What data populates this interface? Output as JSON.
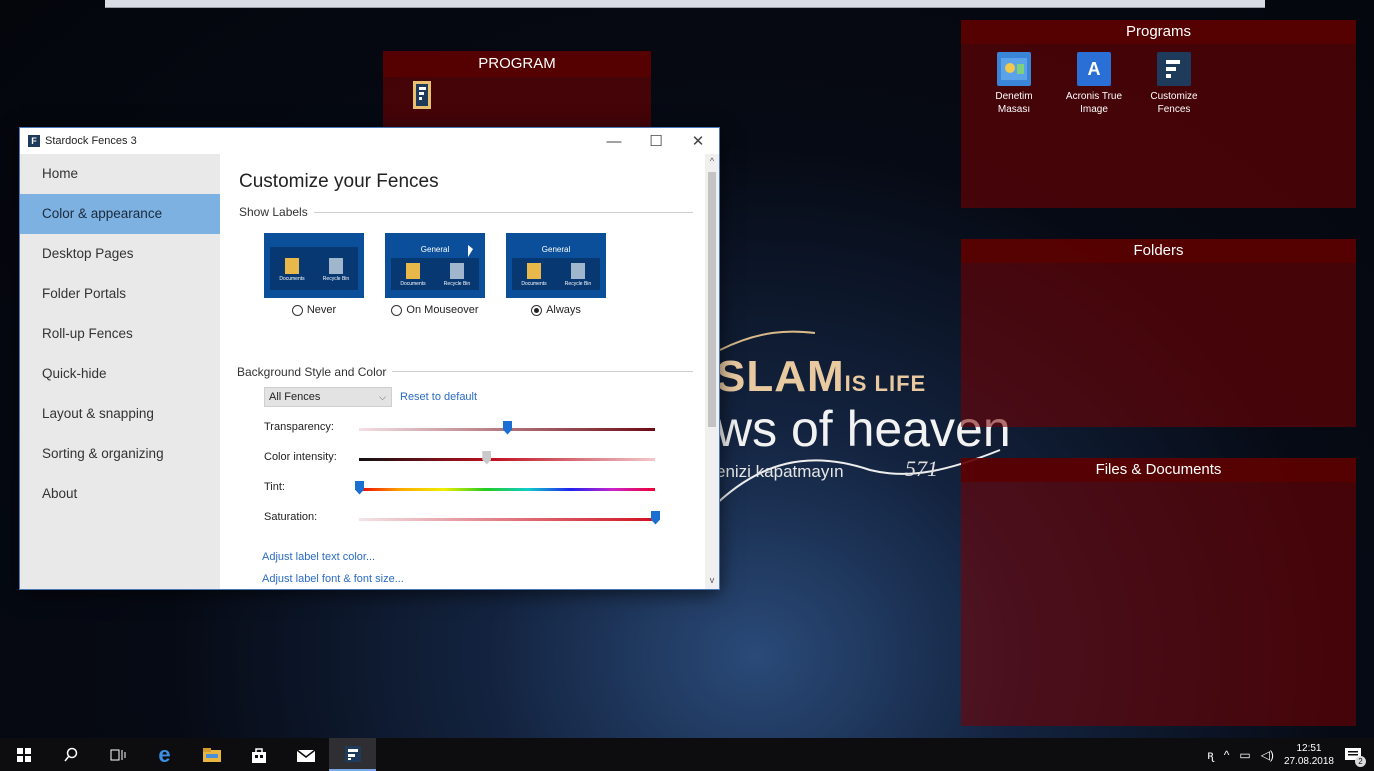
{
  "wallpaper": {
    "line1_big": "SLAM",
    "line1_small": "IS LIFE",
    "line2": "ws of heaven",
    "line3": "enizi kapatmayın",
    "numeral": "571"
  },
  "fences": {
    "program": {
      "title": "PROGRAM",
      "icons": [
        {
          "icon": "fences-app-icon"
        }
      ]
    },
    "programs": {
      "title": "Programs",
      "icons": [
        {
          "label": "Denetim Masası",
          "icon": "control-panel-icon"
        },
        {
          "label": "Acronis True Image",
          "icon": "acronis-icon",
          "glyph": "A"
        },
        {
          "label": "Customize Fences",
          "icon": "fences-app-icon"
        }
      ]
    },
    "folders": {
      "title": "Folders"
    },
    "files": {
      "title": "Files & Documents"
    }
  },
  "window": {
    "title": "Stardock Fences 3",
    "controls": {
      "minimize": "—",
      "maximize": "☐",
      "close": "✕"
    },
    "nav": [
      {
        "label": "Home"
      },
      {
        "label": "Color & appearance",
        "active": true
      },
      {
        "label": "Desktop Pages"
      },
      {
        "label": "Folder Portals"
      },
      {
        "label": "Roll-up Fences"
      },
      {
        "label": "Quick-hide"
      },
      {
        "label": "Layout & snapping"
      },
      {
        "label": "Sorting & organizing"
      },
      {
        "label": "About"
      }
    ],
    "page_title": "Customize your Fences",
    "show_labels": {
      "heading": "Show Labels",
      "preview_title": "General",
      "preview_items": [
        "Documents",
        "Recycle Bin"
      ],
      "options": [
        {
          "label": "Never",
          "selected": false
        },
        {
          "label": "On Mouseover",
          "selected": false
        },
        {
          "label": "Always",
          "selected": true
        }
      ]
    },
    "background": {
      "heading": "Background Style and Color",
      "select_value": "All Fences",
      "reset_link": "Reset to default",
      "sliders": [
        {
          "label": "Transparency:",
          "value": 0.5
        },
        {
          "label": "Color intensity:",
          "value": 0.43
        },
        {
          "label": "Tint:",
          "value": 0.0
        },
        {
          "label": "Saturation:",
          "value": 1.0
        }
      ]
    },
    "links": [
      "Adjust label text color...",
      "Adjust label font & font size..."
    ]
  },
  "taskbar": {
    "items": [
      "windows-start-icon",
      "search-icon",
      "task-view-icon",
      "edge-icon",
      "file-explorer-icon",
      "store-icon",
      "mail-icon",
      "fences-app-icon"
    ],
    "time": "12:51",
    "date": "27.08.2018",
    "notifications": "2"
  }
}
